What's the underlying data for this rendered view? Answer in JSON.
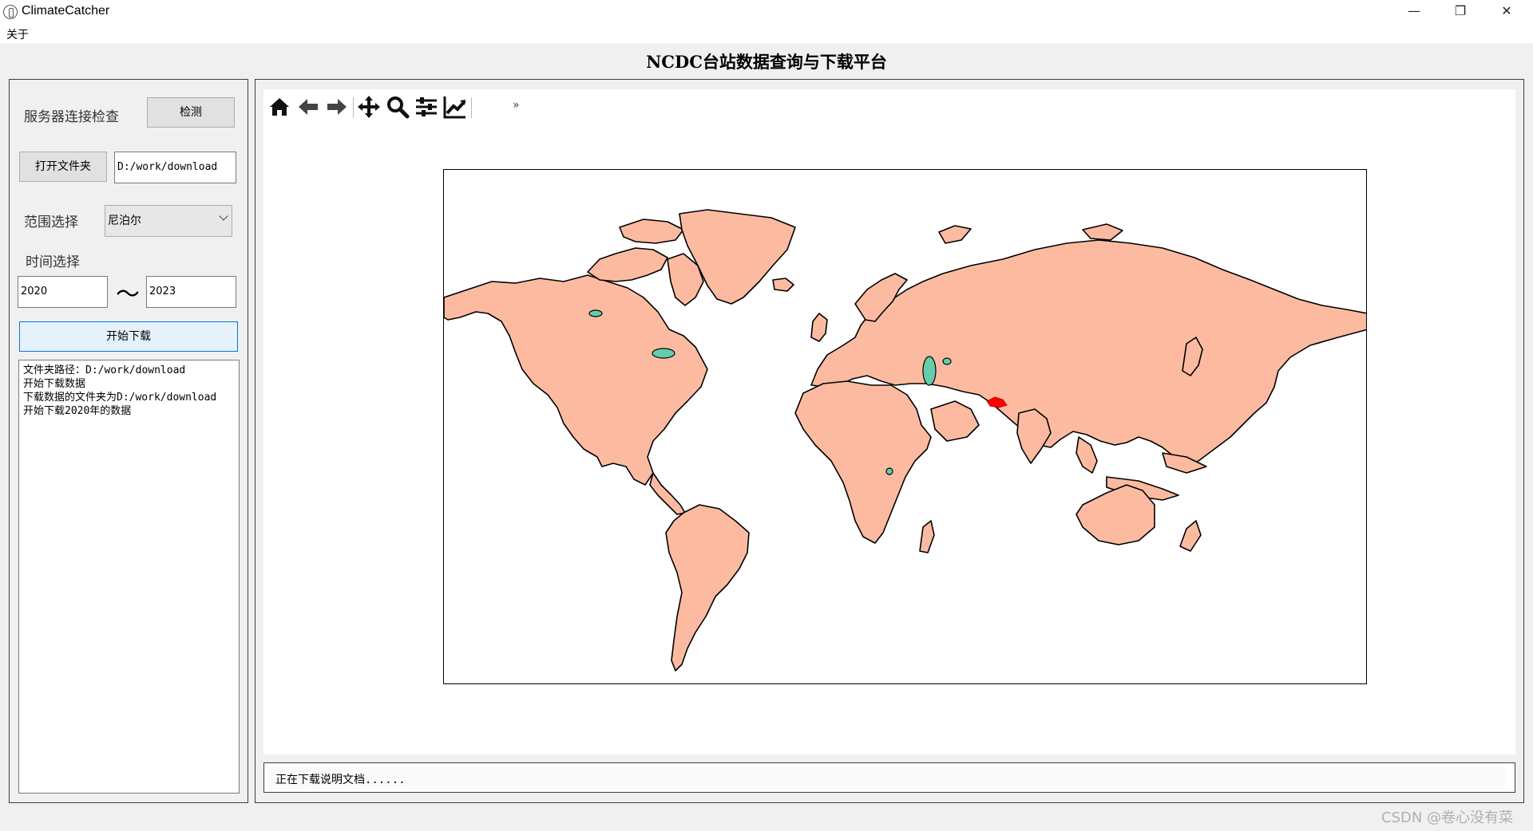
{
  "window": {
    "title": "ClimateCatcher",
    "minimize_glyph": "—",
    "maximize_glyph": "❐",
    "close_glyph": "✕"
  },
  "menu": {
    "items": [
      {
        "label": "关于"
      }
    ]
  },
  "header": {
    "title": "NCDC台站数据查询与下载平台"
  },
  "left": {
    "server_check": {
      "label": "服务器连接检查",
      "button": "检测"
    },
    "folder": {
      "button": "打开文件夹",
      "path": "D:/work/download"
    },
    "region": {
      "label": "范围选择",
      "selected": "尼泊尔"
    },
    "time": {
      "label": "时间选择",
      "start": "2020",
      "end": "2023",
      "separator": "〜"
    },
    "download_button": "开始下载",
    "log": [
      "文件夹路径：D:/work/download",
      "开始下载数据",
      "下载数据的文件夹为D:/work/download",
      "开始下载2020年的数据"
    ]
  },
  "toolbar": {
    "icons": [
      "home-icon",
      "back-icon",
      "forward-icon",
      "pan-icon",
      "zoom-icon",
      "configure-subplots-icon",
      "edit-axis-icon"
    ],
    "more_glyph": "»"
  },
  "map": {
    "land_color": "#fcbba1",
    "lake_color": "#66cdaa",
    "highlight_color": "#ff0000",
    "highlight_region": "尼泊尔"
  },
  "status": {
    "text": "正在下载说明文档......"
  },
  "watermark": "CSDN @卷心没有菜"
}
